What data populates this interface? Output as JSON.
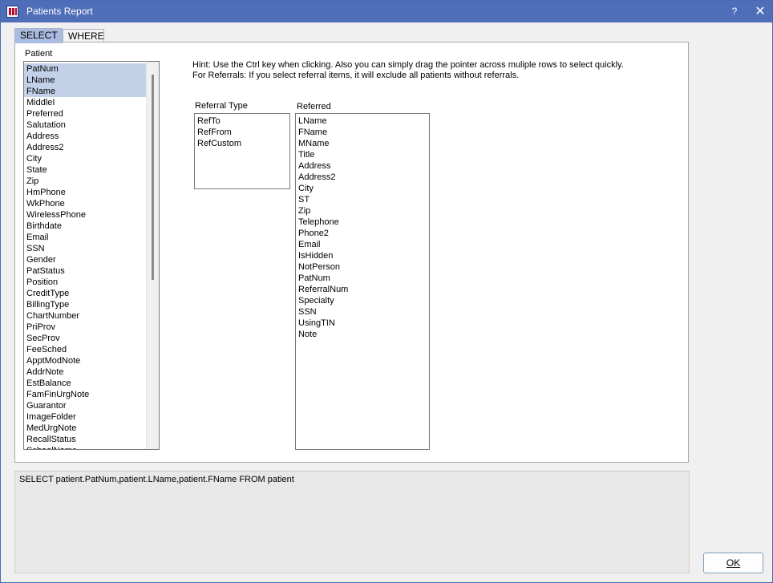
{
  "window": {
    "title": "Patients Report",
    "help_label": "?",
    "close_label": "✕"
  },
  "tabs": [
    {
      "label": "SELECT"
    },
    {
      "label": "WHERE"
    }
  ],
  "patient": {
    "label": "Patient",
    "items": [
      "PatNum",
      "LName",
      "FName",
      "MiddleI",
      "Preferred",
      "Salutation",
      "Address",
      "Address2",
      "City",
      "State",
      "Zip",
      "HmPhone",
      "WkPhone",
      "WirelessPhone",
      "Birthdate",
      "Email",
      "SSN",
      "Gender",
      "PatStatus",
      "Position",
      "CreditType",
      "BillingType",
      "ChartNumber",
      "PriProv",
      "SecProv",
      "FeeSched",
      "ApptModNote",
      "AddrNote",
      "EstBalance",
      "FamFinUrgNote",
      "Guarantor",
      "ImageFolder",
      "MedUrgNote",
      "RecallStatus",
      "SchoolName"
    ],
    "selected": [
      "PatNum",
      "LName",
      "FName"
    ]
  },
  "hint": {
    "line1": "Hint: Use the Ctrl key when clicking.  Also you can simply drag the pointer across muliple rows to select quickly.",
    "line2": "For Referrals: If you select referral items, it will exclude all patients without referrals."
  },
  "referral_type": {
    "label": "Referral Type",
    "items": [
      "RefTo",
      "RefFrom",
      "RefCustom"
    ]
  },
  "referred": {
    "label": "Referred",
    "items": [
      "LName",
      "FName",
      "MName",
      "Title",
      "Address",
      "Address2",
      "City",
      "ST",
      "Zip",
      "Telephone",
      "Phone2",
      "Email",
      "IsHidden",
      "NotPerson",
      "PatNum",
      "ReferralNum",
      "Specialty",
      "SSN",
      "UsingTIN",
      "Note"
    ]
  },
  "query_text": "SELECT patient.PatNum,patient.LName,patient.FName FROM patient",
  "ok_label": "OK"
}
